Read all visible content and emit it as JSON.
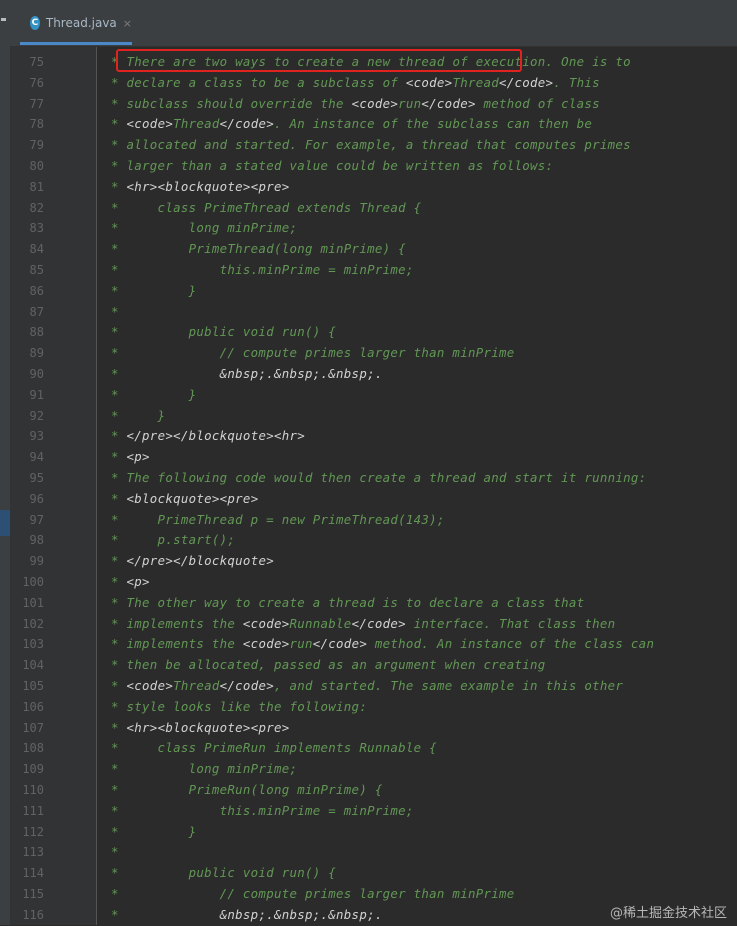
{
  "tab": {
    "label": "Thread.java",
    "icon_letter": "C",
    "close": "×"
  },
  "lines": [
    {
      "n": "75",
      "segs": [
        [
          "c",
          "* "
        ],
        [
          "c",
          "There are two ways to create a new thread of execution."
        ],
        [
          "c",
          " One is to"
        ]
      ]
    },
    {
      "n": "76",
      "segs": [
        [
          "c",
          "* declare a class to be a subclass of "
        ],
        [
          "t",
          "<code>"
        ],
        [
          "c",
          "Thread"
        ],
        [
          "t",
          "</code>"
        ],
        [
          "c",
          ". This"
        ]
      ]
    },
    {
      "n": "77",
      "segs": [
        [
          "c",
          "* subclass should override the "
        ],
        [
          "t",
          "<code>"
        ],
        [
          "c",
          "run"
        ],
        [
          "t",
          "</code>"
        ],
        [
          "c",
          " method of class"
        ]
      ]
    },
    {
      "n": "78",
      "segs": [
        [
          "c",
          "* "
        ],
        [
          "t",
          "<code>"
        ],
        [
          "c",
          "Thread"
        ],
        [
          "t",
          "</code>"
        ],
        [
          "c",
          ". An instance of the subclass can then be"
        ]
      ]
    },
    {
      "n": "79",
      "segs": [
        [
          "c",
          "* allocated and started. For example, a thread that computes primes"
        ]
      ]
    },
    {
      "n": "80",
      "segs": [
        [
          "c",
          "* larger than a stated value could be written as follows:"
        ]
      ]
    },
    {
      "n": "81",
      "segs": [
        [
          "c",
          "* "
        ],
        [
          "t",
          "<hr><blockquote><pre>"
        ]
      ]
    },
    {
      "n": "82",
      "segs": [
        [
          "c",
          "*     class PrimeThread extends Thread {"
        ]
      ]
    },
    {
      "n": "83",
      "segs": [
        [
          "c",
          "*         long minPrime;"
        ]
      ]
    },
    {
      "n": "84",
      "segs": [
        [
          "c",
          "*         PrimeThread(long minPrime) {"
        ]
      ]
    },
    {
      "n": "85",
      "segs": [
        [
          "c",
          "*             this.minPrime = minPrime;"
        ]
      ]
    },
    {
      "n": "86",
      "segs": [
        [
          "c",
          "*         }"
        ]
      ]
    },
    {
      "n": "87",
      "segs": [
        [
          "c",
          "*"
        ]
      ]
    },
    {
      "n": "88",
      "segs": [
        [
          "c",
          "*         public void run() {"
        ]
      ]
    },
    {
      "n": "89",
      "segs": [
        [
          "c",
          "*             // compute primes larger than minPrime"
        ]
      ]
    },
    {
      "n": "90",
      "segs": [
        [
          "c",
          "*             "
        ],
        [
          "t",
          "&nbsp;.&nbsp;.&nbsp;."
        ]
      ]
    },
    {
      "n": "91",
      "segs": [
        [
          "c",
          "*         }"
        ]
      ]
    },
    {
      "n": "92",
      "segs": [
        [
          "c",
          "*     }"
        ]
      ]
    },
    {
      "n": "93",
      "segs": [
        [
          "c",
          "* "
        ],
        [
          "t",
          "</pre></blockquote><hr>"
        ]
      ]
    },
    {
      "n": "94",
      "segs": [
        [
          "c",
          "* "
        ],
        [
          "t",
          "<p>"
        ]
      ]
    },
    {
      "n": "95",
      "segs": [
        [
          "c",
          "* The following code would then create a thread and start it running:"
        ]
      ]
    },
    {
      "n": "96",
      "segs": [
        [
          "c",
          "* "
        ],
        [
          "t",
          "<blockquote><pre>"
        ]
      ]
    },
    {
      "n": "97",
      "segs": [
        [
          "c",
          "*     PrimeThread p = new PrimeThread(143);"
        ]
      ]
    },
    {
      "n": "98",
      "segs": [
        [
          "c",
          "*     p.start();"
        ]
      ]
    },
    {
      "n": "99",
      "segs": [
        [
          "c",
          "* "
        ],
        [
          "t",
          "</pre></blockquote>"
        ]
      ]
    },
    {
      "n": "100",
      "segs": [
        [
          "c",
          "* "
        ],
        [
          "t",
          "<p>"
        ]
      ]
    },
    {
      "n": "101",
      "segs": [
        [
          "c",
          "* The other way to create a thread is to declare a class that"
        ]
      ]
    },
    {
      "n": "102",
      "segs": [
        [
          "c",
          "* implements the "
        ],
        [
          "t",
          "<code>"
        ],
        [
          "c",
          "Runnable"
        ],
        [
          "t",
          "</code>"
        ],
        [
          "c",
          " interface. That class then"
        ]
      ]
    },
    {
      "n": "103",
      "segs": [
        [
          "c",
          "* implements the "
        ],
        [
          "t",
          "<code>"
        ],
        [
          "c",
          "run"
        ],
        [
          "t",
          "</code>"
        ],
        [
          "c",
          " method. An instance of the class can"
        ]
      ]
    },
    {
      "n": "104",
      "segs": [
        [
          "c",
          "* then be allocated, passed as an argument when creating"
        ]
      ]
    },
    {
      "n": "105",
      "segs": [
        [
          "c",
          "* "
        ],
        [
          "t",
          "<code>"
        ],
        [
          "c",
          "Thread"
        ],
        [
          "t",
          "</code>"
        ],
        [
          "c",
          ", and started. The same example in this other"
        ]
      ]
    },
    {
      "n": "106",
      "segs": [
        [
          "c",
          "* style looks like the following:"
        ]
      ]
    },
    {
      "n": "107",
      "segs": [
        [
          "c",
          "* "
        ],
        [
          "t",
          "<hr><blockquote><pre>"
        ]
      ]
    },
    {
      "n": "108",
      "segs": [
        [
          "c",
          "*     class PrimeRun implements Runnable {"
        ]
      ]
    },
    {
      "n": "109",
      "segs": [
        [
          "c",
          "*         long minPrime;"
        ]
      ]
    },
    {
      "n": "110",
      "segs": [
        [
          "c",
          "*         PrimeRun(long minPrime) {"
        ]
      ]
    },
    {
      "n": "111",
      "segs": [
        [
          "c",
          "*             this.minPrime = minPrime;"
        ]
      ]
    },
    {
      "n": "112",
      "segs": [
        [
          "c",
          "*         }"
        ]
      ]
    },
    {
      "n": "113",
      "segs": [
        [
          "c",
          "*"
        ]
      ]
    },
    {
      "n": "114",
      "segs": [
        [
          "c",
          "*         public void run() {"
        ]
      ]
    },
    {
      "n": "115",
      "segs": [
        [
          "c",
          "*             // compute primes larger than minPrime"
        ]
      ]
    },
    {
      "n": "116",
      "segs": [
        [
          "c",
          "*             "
        ],
        [
          "t",
          "&nbsp;.&nbsp;.&nbsp;."
        ]
      ]
    }
  ],
  "watermark": "@稀土掘金技术社区",
  "colors": {
    "comment": "#629755",
    "tag": "#d2d2d2",
    "line_number": "#606366",
    "highlight": "#e0231f",
    "background": "#2b2b2b"
  }
}
